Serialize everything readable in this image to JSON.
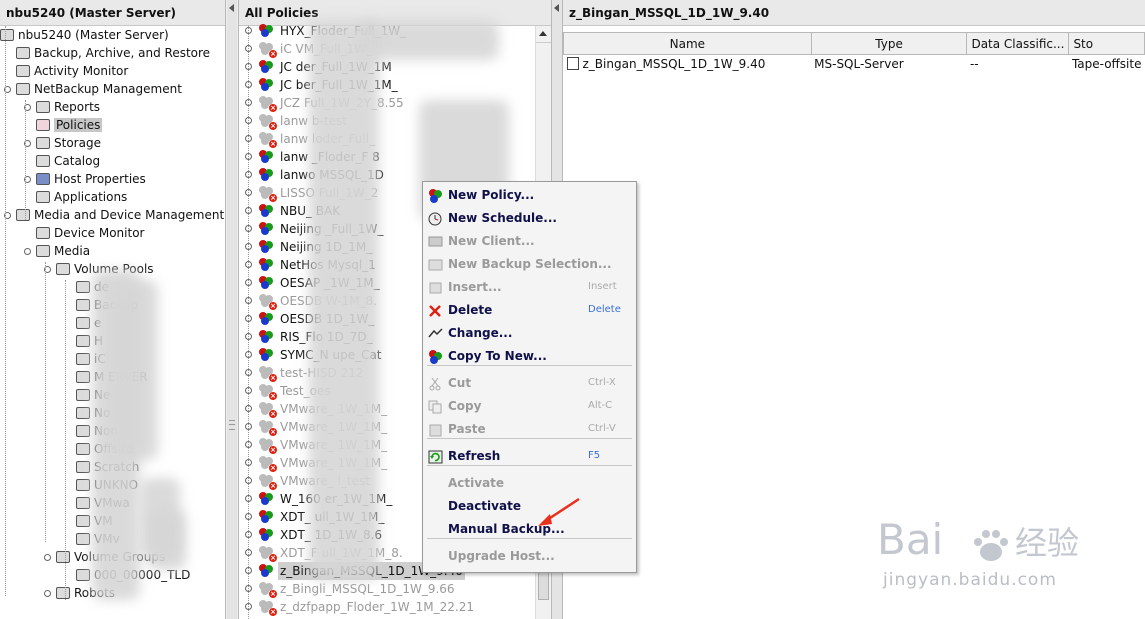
{
  "left": {
    "title": "nbu5240 (Master Server)",
    "items": [
      {
        "label": "nbu5240 (Master Server)",
        "icon": "server-icon"
      },
      {
        "label": "Backup, Archive, and Restore",
        "icon": "backup-icon"
      },
      {
        "label": "Activity Monitor",
        "icon": "monitor-icon"
      },
      {
        "label": "NetBackup Management",
        "icon": "management-icon"
      },
      {
        "label": "Reports",
        "icon": "report-icon"
      },
      {
        "label": "Policies",
        "icon": "policy-icon"
      },
      {
        "label": "Storage",
        "icon": "storage-icon"
      },
      {
        "label": "Catalog",
        "icon": "catalog-icon"
      },
      {
        "label": "Host Properties",
        "icon": "host-icon"
      },
      {
        "label": "Applications",
        "icon": "application-icon"
      },
      {
        "label": "Media and Device Management",
        "icon": "media-device-icon"
      },
      {
        "label": "Device Monitor",
        "icon": "device-monitor-icon"
      },
      {
        "label": "Media",
        "icon": "media-icon"
      },
      {
        "label": "Volume Pools",
        "icon": "volume-pools-icon"
      },
      {
        "label": "de",
        "icon": "volume-icon"
      },
      {
        "label": "Backup",
        "icon": "volume-icon"
      },
      {
        "label": "e",
        "icon": "volume-icon"
      },
      {
        "label": "H",
        "icon": "volume-icon"
      },
      {
        "label": "iC",
        "icon": "volume-icon"
      },
      {
        "label": "M         ERVER",
        "icon": "volume-icon"
      },
      {
        "label": "Ne",
        "icon": "volume-icon"
      },
      {
        "label": "No",
        "icon": "volume-icon"
      },
      {
        "label": "Non",
        "icon": "volume-icon"
      },
      {
        "label": "Offsite",
        "icon": "volume-icon"
      },
      {
        "label": "Scratch",
        "icon": "volume-icon"
      },
      {
        "label": "UNKNO",
        "icon": "volume-icon"
      },
      {
        "label": "VMwa",
        "icon": "volume-icon"
      },
      {
        "label": "VM",
        "icon": "volume-icon"
      },
      {
        "label": "VMv",
        "icon": "volume-icon"
      },
      {
        "label": "Volume Groups",
        "icon": "volume-groups-icon"
      },
      {
        "label": "000_00000_TLD",
        "icon": "volume-group-icon"
      },
      {
        "label": "Robots",
        "icon": "robot-icon"
      }
    ]
  },
  "middle": {
    "title": "All Policies",
    "policies": [
      {
        "label": "HYX_Floder_Full_1W_",
        "active": true
      },
      {
        "label": "iC       VM_Full_1W_",
        "active": false
      },
      {
        "label": "JC       der_Full_1W_1M",
        "active": true
      },
      {
        "label": "JC       ber_Full_1W_1M_",
        "active": true
      },
      {
        "label": "JCZ      Full_1W_2Y_8.55",
        "active": false
      },
      {
        "label": "lanw          b-test",
        "active": false
      },
      {
        "label": "lanw       loder_Full_",
        "active": false
      },
      {
        "label": "lanw       _Floder_F           8",
        "active": true
      },
      {
        "label": "lanwo      MSSQL_1D",
        "active": true
      },
      {
        "label": "LISSO      Full_1W_2",
        "active": false
      },
      {
        "label": "NBU_          BAK",
        "active": true
      },
      {
        "label": "Neijing       _Full_1W_",
        "active": true
      },
      {
        "label": "Neijing         1D_1M_",
        "active": true
      },
      {
        "label": "NetHos         Mysql_1",
        "active": true
      },
      {
        "label": "OESAP         _1W_1M_",
        "active": true
      },
      {
        "label": "OESDB          W-1M_8.",
        "active": false
      },
      {
        "label": "OESDB          1D_1W_",
        "active": true
      },
      {
        "label": "RIS_Flo         1D_7D_",
        "active": true
      },
      {
        "label": "SYMC_N          upe_Cat",
        "active": true
      },
      {
        "label": "test-HISD          212",
        "active": false
      },
      {
        "label": "Test_oes",
        "active": false
      },
      {
        "label": "VMware_        1W_1M_",
        "active": false
      },
      {
        "label": "VMware_        1W_1M_",
        "active": false
      },
      {
        "label": "VMware_        1W_1M_",
        "active": false
      },
      {
        "label": "VMware_        1W_1M_",
        "active": false
      },
      {
        "label": "VMware_        l_test",
        "active": false
      },
      {
        "label": "W_160         er_1W_1M_",
        "active": true
      },
      {
        "label": "XDT_        ull_1W_1M_",
        "active": true
      },
      {
        "label": "XDT_        1D_1W_8.6",
        "active": true
      },
      {
        "label": "XDT_F       ull_1W_1M_8.",
        "active": false
      },
      {
        "label": "z_Bingan_MSSQL_1D_1W_9.40",
        "active": true,
        "selected": true
      },
      {
        "label": "z_Bingli_MSSQL_1D_1W_9.66",
        "active": false
      },
      {
        "label": "z_dzfpapp_Floder_1W_1M_22.21",
        "active": false
      }
    ]
  },
  "right": {
    "title": "z_Bingan_MSSQL_1D_1W_9.40",
    "columns": [
      "Name",
      "Type",
      "Data Classific...",
      "Sto"
    ],
    "rows": [
      {
        "name": "z_Bingan_MSSQL_1D_1W_9.40",
        "type": "MS-SQL-Server",
        "data_classification": "--",
        "storage": "Tape-offsite"
      }
    ]
  },
  "context_menu": {
    "items": [
      {
        "label": "New Policy...",
        "shortcut": "",
        "enabled": true,
        "icon": "new-policy-icon"
      },
      {
        "label": "New Schedule...",
        "shortcut": "",
        "enabled": true,
        "icon": "new-schedule-icon"
      },
      {
        "label": "New Client...",
        "shortcut": "",
        "enabled": false,
        "icon": "new-client-icon"
      },
      {
        "label": "New Backup Selection...",
        "shortcut": "",
        "enabled": false,
        "icon": "new-backup-selection-icon"
      },
      {
        "label": "Insert...",
        "shortcut": "Insert",
        "enabled": false,
        "icon": "insert-icon"
      },
      {
        "label": "Delete",
        "shortcut": "Delete",
        "enabled": true,
        "icon": "delete-icon"
      },
      {
        "label": "Change...",
        "shortcut": "",
        "enabled": true,
        "icon": "change-icon"
      },
      {
        "label": "Copy To New...",
        "shortcut": "",
        "enabled": true,
        "icon": "copy-to-new-icon"
      },
      {
        "label": "Cut",
        "shortcut": "Ctrl-X",
        "enabled": false,
        "icon": "cut-icon"
      },
      {
        "label": "Copy",
        "shortcut": "Alt-C",
        "enabled": false,
        "icon": "copy-icon"
      },
      {
        "label": "Paste",
        "shortcut": "Ctrl-V",
        "enabled": false,
        "icon": "paste-icon"
      },
      {
        "label": "Refresh",
        "shortcut": "F5",
        "enabled": true,
        "icon": "refresh-icon"
      },
      {
        "label": "Activate",
        "shortcut": "",
        "enabled": false,
        "icon": ""
      },
      {
        "label": "Deactivate",
        "shortcut": "",
        "enabled": true,
        "icon": ""
      },
      {
        "label": "Manual Backup...",
        "shortcut": "",
        "enabled": true,
        "icon": ""
      },
      {
        "label": "Upgrade Host...",
        "shortcut": "",
        "enabled": false,
        "icon": ""
      }
    ]
  },
  "watermark": {
    "logo_text": "Bai 经验",
    "url": "jingyan.baidu.com"
  },
  "colors": {
    "accent_red": "#e8301c",
    "menu_text": "#10104a",
    "disabled_text": "#9a9a9a",
    "shortcut_blue": "#3a6fd8"
  }
}
